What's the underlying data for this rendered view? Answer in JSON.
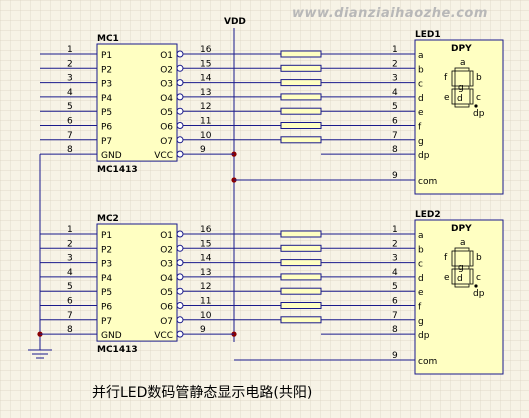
{
  "watermark": "www.dianziaihaozhe.com",
  "vdd_label": "VDD",
  "caption": "并行LED数码管静态显示电路(共阳)",
  "chips": [
    {
      "name": "MC1",
      "part": "MC1413",
      "left_pins": [
        {
          "num": "1",
          "label": "P1"
        },
        {
          "num": "2",
          "label": "P2"
        },
        {
          "num": "3",
          "label": "P3"
        },
        {
          "num": "4",
          "label": "P4"
        },
        {
          "num": "5",
          "label": "P5"
        },
        {
          "num": "6",
          "label": "P6"
        },
        {
          "num": "7",
          "label": "P7"
        },
        {
          "num": "8",
          "label": "GND"
        }
      ],
      "right_pins": [
        {
          "label": "O1",
          "num": "16"
        },
        {
          "label": "O2",
          "num": "15"
        },
        {
          "label": "O3",
          "num": "14"
        },
        {
          "label": "O4",
          "num": "13"
        },
        {
          "label": "O5",
          "num": "12"
        },
        {
          "label": "O6",
          "num": "11"
        },
        {
          "label": "O7",
          "num": "10"
        },
        {
          "label": "VCC",
          "num": "9"
        }
      ]
    },
    {
      "name": "MC2",
      "part": "MC1413",
      "left_pins": [
        {
          "num": "1",
          "label": "P1"
        },
        {
          "num": "2",
          "label": "P2"
        },
        {
          "num": "3",
          "label": "P3"
        },
        {
          "num": "4",
          "label": "P4"
        },
        {
          "num": "5",
          "label": "P5"
        },
        {
          "num": "6",
          "label": "P6"
        },
        {
          "num": "7",
          "label": "P7"
        },
        {
          "num": "8",
          "label": "GND"
        }
      ],
      "right_pins": [
        {
          "label": "O1",
          "num": "16"
        },
        {
          "label": "O2",
          "num": "15"
        },
        {
          "label": "O3",
          "num": "14"
        },
        {
          "label": "O4",
          "num": "13"
        },
        {
          "label": "O5",
          "num": "12"
        },
        {
          "label": "O6",
          "num": "11"
        },
        {
          "label": "O7",
          "num": "10"
        },
        {
          "label": "VCC",
          "num": "9"
        }
      ]
    }
  ],
  "displays": [
    {
      "name": "LED1",
      "title": "DPY",
      "pins": [
        {
          "num": "1",
          "label": "a"
        },
        {
          "num": "2",
          "label": "b"
        },
        {
          "num": "3",
          "label": "c"
        },
        {
          "num": "4",
          "label": "d"
        },
        {
          "num": "5",
          "label": "e"
        },
        {
          "num": "6",
          "label": "f"
        },
        {
          "num": "7",
          "label": "g"
        },
        {
          "num": "8",
          "label": "dp"
        }
      ],
      "com_num": "9",
      "com_label": "com",
      "segments": {
        "a": "a",
        "b": "b",
        "c": "c",
        "d": "d",
        "e": "e",
        "f": "f",
        "g": "g",
        "dp": "dp"
      }
    },
    {
      "name": "LED2",
      "title": "DPY",
      "pins": [
        {
          "num": "1",
          "label": "a"
        },
        {
          "num": "2",
          "label": "b"
        },
        {
          "num": "3",
          "label": "c"
        },
        {
          "num": "4",
          "label": "d"
        },
        {
          "num": "5",
          "label": "e"
        },
        {
          "num": "6",
          "label": "f"
        },
        {
          "num": "7",
          "label": "g"
        },
        {
          "num": "8",
          "label": "dp"
        }
      ],
      "com_num": "9",
      "com_label": "com",
      "segments": {
        "a": "a",
        "b": "b",
        "c": "c",
        "d": "d",
        "e": "e",
        "f": "f",
        "g": "g",
        "dp": "dp"
      }
    }
  ],
  "colors": {
    "background": "#f7f3e6",
    "grid": "#d9d2c0",
    "wire": "#1a1a8c",
    "component_fill": "#ffffc2",
    "junction": "#8b0000"
  }
}
